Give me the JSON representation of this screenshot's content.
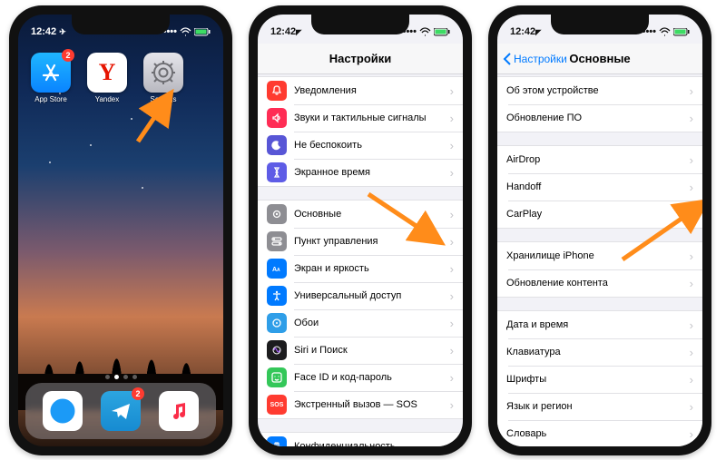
{
  "status": {
    "time": "12:42",
    "loc_arrow": "◤"
  },
  "phone1": {
    "apps": [
      {
        "name": "App Store",
        "badge": "2",
        "bg": "linear-gradient(180deg,#1fb6ff,#0a84ff)"
      },
      {
        "name": "Yandex",
        "badge": null,
        "bg": "#fff"
      },
      {
        "name": "Settings",
        "badge": null,
        "bg": "linear-gradient(180deg,#e5e5ea,#b8b8c0)"
      }
    ],
    "dock": [
      {
        "name": "Safari",
        "bg": "#fff"
      },
      {
        "name": "Telegram",
        "bg": "linear-gradient(180deg,#2ca5e0,#178bd1)",
        "badge": "2"
      },
      {
        "name": "Music",
        "bg": "#fff"
      }
    ]
  },
  "phone2": {
    "title": "Настройки",
    "groups": [
      [
        {
          "icon": "bell",
          "color": "bg-red",
          "label": "Уведомления"
        },
        {
          "icon": "sound",
          "color": "bg-pink",
          "label": "Звуки и тактильные сигналы"
        },
        {
          "icon": "moon",
          "color": "bg-purple",
          "label": "Не беспокоить"
        },
        {
          "icon": "hour",
          "color": "bg-indigo",
          "label": "Экранное время"
        }
      ],
      [
        {
          "icon": "gear",
          "color": "bg-grey",
          "label": "Основные"
        },
        {
          "icon": "toggles",
          "color": "bg-grey",
          "label": "Пункт управления"
        },
        {
          "icon": "aa",
          "color": "bg-blue",
          "label": "Экран и яркость"
        },
        {
          "icon": "access",
          "color": "bg-blue",
          "label": "Универсальный доступ"
        },
        {
          "icon": "wall",
          "color": "bg-sky",
          "label": "Обои"
        },
        {
          "icon": "siri",
          "color": "bg-black",
          "label": "Siri и Поиск"
        },
        {
          "icon": "faceid",
          "color": "bg-teal",
          "label": "Face ID и код-пароль"
        },
        {
          "icon": "sos",
          "color": "bg-sos",
          "label": "Экстренный вызов — SOS"
        }
      ],
      [
        {
          "icon": "hand",
          "color": "bg-blue",
          "label": "Конфиденциальность"
        }
      ]
    ]
  },
  "phone3": {
    "back": "Настройки",
    "title": "Основные",
    "groups": [
      [
        {
          "label": "Об этом устройстве"
        },
        {
          "label": "Обновление ПО"
        }
      ],
      [
        {
          "label": "AirDrop"
        },
        {
          "label": "Handoff"
        },
        {
          "label": "CarPlay"
        }
      ],
      [
        {
          "label": "Хранилище iPhone"
        },
        {
          "label": "Обновление контента"
        }
      ],
      [
        {
          "label": "Дата и время"
        },
        {
          "label": "Клавиатура"
        },
        {
          "label": "Шрифты"
        },
        {
          "label": "Язык и регион"
        },
        {
          "label": "Словарь"
        }
      ]
    ]
  }
}
